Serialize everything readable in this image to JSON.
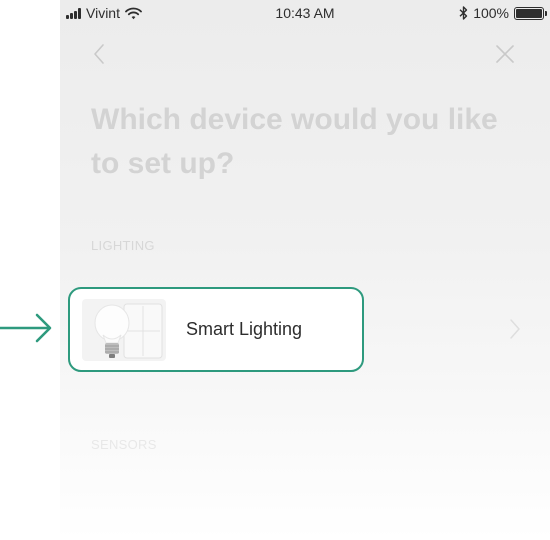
{
  "status_bar": {
    "carrier": "Vivint",
    "time": "10:43 AM",
    "battery_text": "100%",
    "battery_level": 1.0
  },
  "nav": {
    "back_icon": "chevron-left-icon",
    "close_icon": "close-icon"
  },
  "page": {
    "title": "Which device would you like to set up?"
  },
  "sections": {
    "lighting_label": "LIGHTING",
    "sensors_label": "SENSORS"
  },
  "highlight": {
    "card_label": "Smart Lighting",
    "thumb_icon": "light-bulb-and-switch-icon",
    "pointer_icon": "arrow-right-icon",
    "accent_color": "#2e9a7e"
  }
}
